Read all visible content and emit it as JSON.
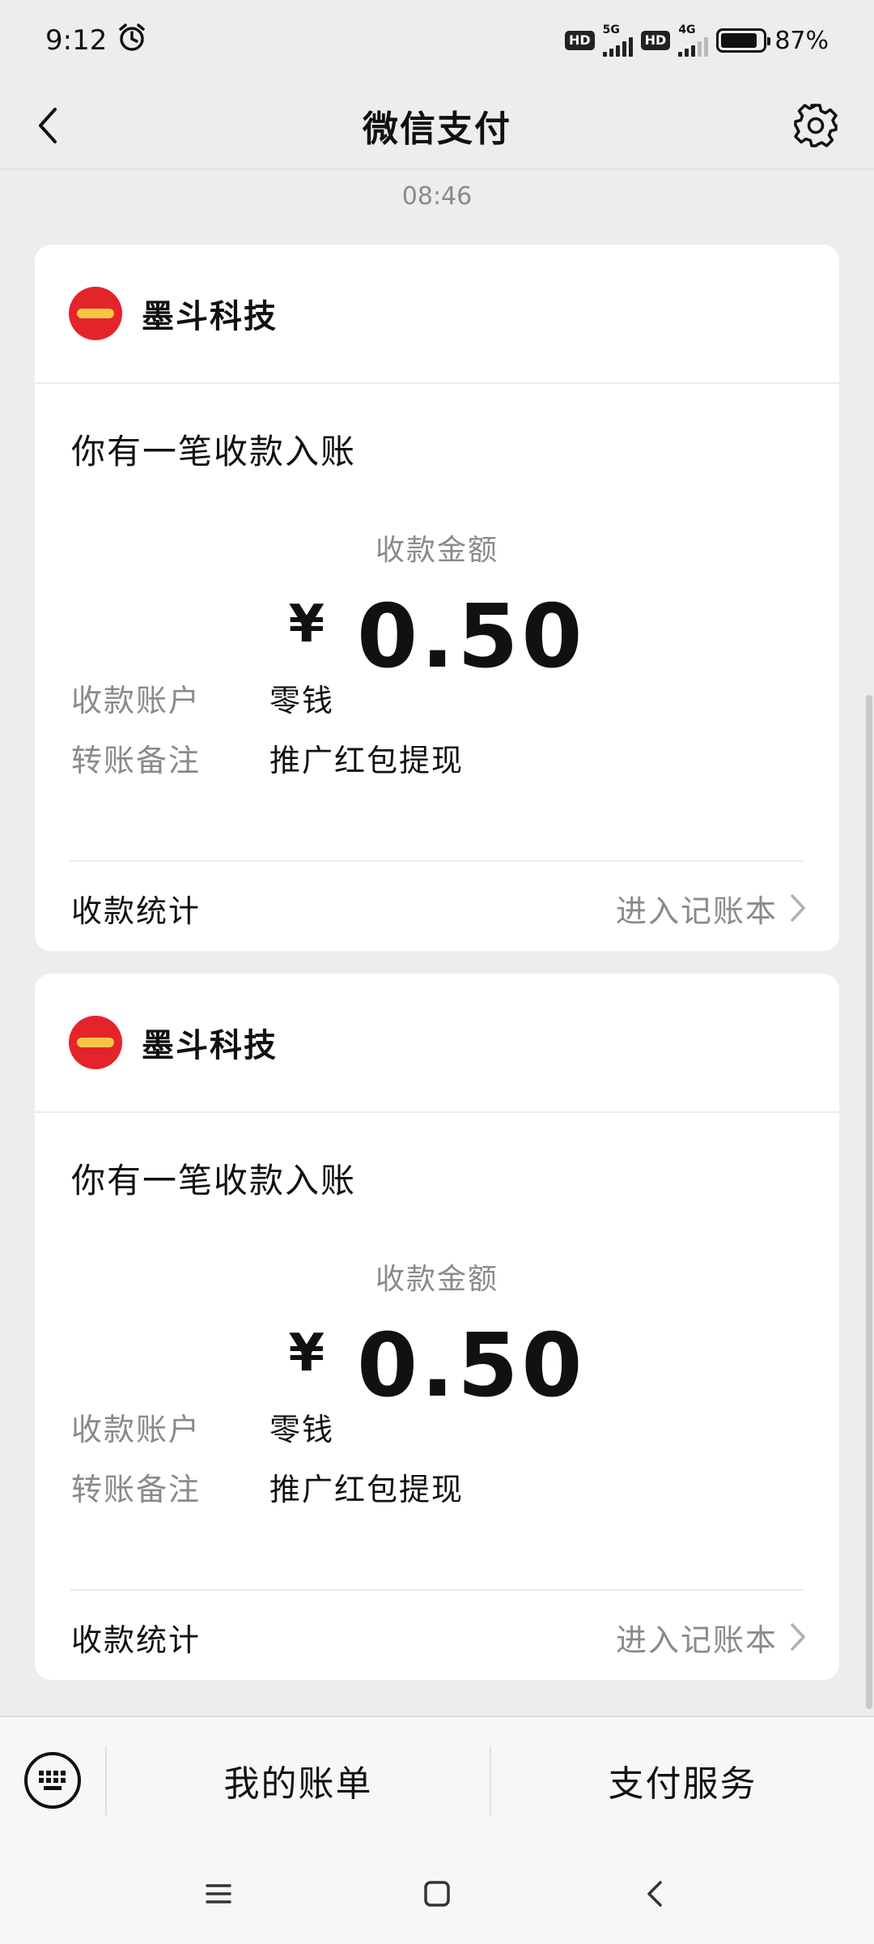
{
  "status_bar": {
    "time": "9:12",
    "net1_type": "5G",
    "net2_type": "4G",
    "hd_label": "HD",
    "battery_level": 0.87,
    "battery_text": "87%"
  },
  "header": {
    "title": "微信支付"
  },
  "chat": {
    "timestamp": "08:46"
  },
  "cards": [
    {
      "merchant": "墨斗科技",
      "headline": "你有一笔收款入账",
      "amount_label": "收款金额",
      "currency": "¥",
      "amount": "0.50",
      "rows": [
        {
          "key": "收款账户",
          "value": "零钱"
        },
        {
          "key": "转账备注",
          "value": "推广红包提现"
        }
      ],
      "stats_label": "收款统计",
      "stats_link": "进入记账本"
    },
    {
      "merchant": "墨斗科技",
      "headline": "你有一笔收款入账",
      "amount_label": "收款金额",
      "currency": "¥",
      "amount": "0.50",
      "rows": [
        {
          "key": "收款账户",
          "value": "零钱"
        },
        {
          "key": "转账备注",
          "value": "推广红包提现"
        }
      ],
      "stats_label": "收款统计",
      "stats_link": "进入记账本"
    }
  ],
  "bottom_menu": {
    "items": [
      "我的账单",
      "支付服务"
    ]
  },
  "colors": {
    "background": "#ededed",
    "card": "#ffffff",
    "logo_red": "#e4242b",
    "muted_text": "#8a8a8a"
  },
  "icons": [
    "alarm-icon",
    "back-arrow-icon",
    "gear-icon",
    "chevron-right-icon",
    "keyboard-icon",
    "menu-lines-icon",
    "home-square-icon",
    "nav-back-icon"
  ]
}
